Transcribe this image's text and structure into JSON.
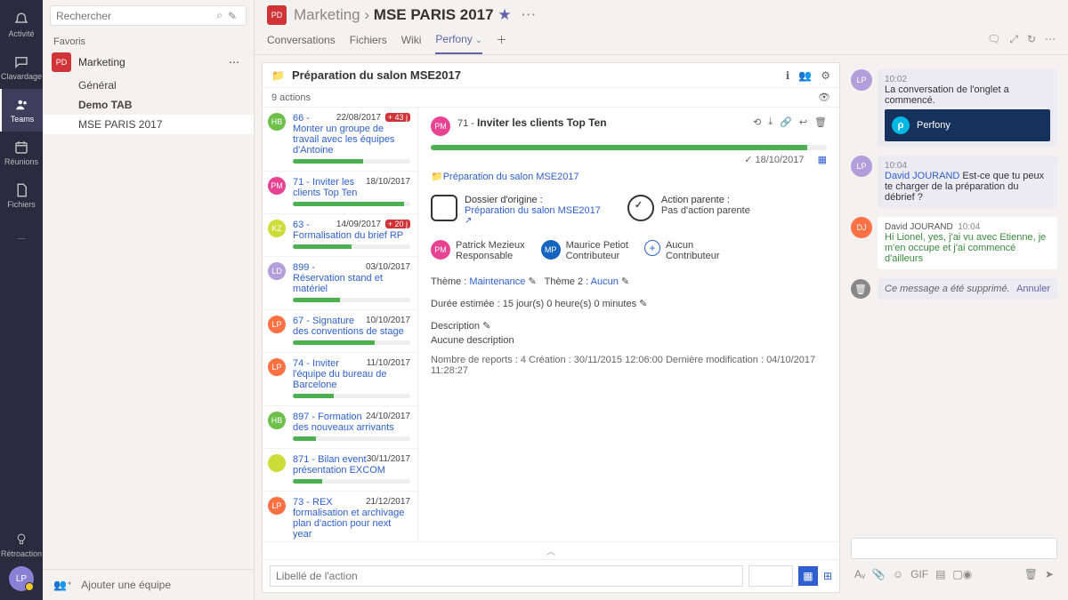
{
  "rail": {
    "items": [
      "Activité",
      "Clavardage",
      "Teams",
      "Réunions",
      "Fichiers"
    ],
    "feedback": "Rétroaction",
    "avatar": "LP"
  },
  "sidebar": {
    "search_placeholder": "Rechercher",
    "favorites_label": "Favoris",
    "team_badge": "PD",
    "team_name": "Marketing",
    "channels": [
      "Général",
      "Demo TAB",
      "MSE PARIS 2017"
    ],
    "add_team": "Ajouter une équipe"
  },
  "header": {
    "badge": "PD",
    "parent": "Marketing",
    "sep": "›",
    "title": "MSE PARIS 2017",
    "tabs": [
      "Conversations",
      "Fichiers",
      "Wiki",
      "Perfony"
    ]
  },
  "perfony": {
    "folder_title": "Préparation du salon MSE2017",
    "actions_count": "9 actions",
    "actions": [
      {
        "av": "HB",
        "color": "#6cc04a",
        "title": "66 - Monter un groupe de travail avec les équipes d'Antoine",
        "date": "22/08/2017",
        "badge": "+ 43 j",
        "progress": 60
      },
      {
        "av": "PM",
        "color": "#e84393",
        "title": "71 - Inviter les clients Top Ten",
        "date": "18/10/2017",
        "progress": 95
      },
      {
        "av": "KZ",
        "color": "#cddc39",
        "title": "63 - Formalisation du brief RP",
        "date": "14/09/2017",
        "badge": "+ 20 j",
        "progress": 50
      },
      {
        "av": "LD",
        "color": "#b39ddb",
        "title": "899 - Réservation stand et matériel",
        "date": "03/10/2017",
        "progress": 40
      },
      {
        "av": "LP",
        "color": "#ff7043",
        "title": "67 - Signature des conventions de stage",
        "date": "10/10/2017",
        "progress": 70
      },
      {
        "av": "LP",
        "color": "#ff7043",
        "title": "74 - Inviter l'équipe du bureau de Barcelone",
        "date": "11/10/2017",
        "progress": 35
      },
      {
        "av": "HB",
        "color": "#6cc04a",
        "title": "897 - Formation des nouveaux arrivants",
        "date": "24/10/2017",
        "progress": 20
      },
      {
        "av": "",
        "color": "#cddc39",
        "title": "871 - Bilan event présentation EXCOM",
        "date": "30/11/2017",
        "progress": 25
      },
      {
        "av": "LP",
        "color": "#ff7043",
        "title": "73 - REX formalisation et archivage plan d'action pour next year",
        "date": "21/12/2017",
        "progress": 5
      }
    ],
    "detail": {
      "num": "71 -",
      "title": "Inviter les clients Top Ten",
      "due_prefix": "✓",
      "due": "18/10/2017",
      "breadcrumb": "📁Préparation du salon MSE2017",
      "dossier_label": "Dossier d'origine :",
      "dossier_value": "Préparation du salon MSE2017",
      "parent_label": "Action parente :",
      "parent_value": "Pas d'action parente",
      "responsable_name": "Patrick Mezieux",
      "responsable_role": "Responsable",
      "contrib1_name": "Maurice Petiot",
      "contrib1_role": "Contributeur",
      "contrib_none": "Aucun",
      "contrib_none_role": "Contributeur",
      "theme_label": "Thème :",
      "theme_value": "Maintenance",
      "theme2_label": "Thème 2 :",
      "theme2_value": "Aucun",
      "duration": "Durée estimée : 15 jour(s) 0 heure(s) 0 minutes ✎",
      "desc_label": "Description ✎",
      "desc_value": "Aucune description",
      "stats": "Nombre de reports : 4    Création : 30/11/2015 12:06:00    Dernière modification : 04/10/2017 11:28:27"
    },
    "input_placeholder": "Libellé de l'action"
  },
  "chat": {
    "messages": [
      {
        "av": "LP",
        "time": "10:02",
        "text": "La conversation de l'onglet a commencé.",
        "card": "Perfony"
      },
      {
        "av": "LP",
        "time": "10:04",
        "author": "David JOURAND",
        "text": "Est-ce que tu peux te charger de la préparation du débrief ?"
      },
      {
        "av": "DJ",
        "avcolor": "#ff7043",
        "author": "David JOURAND",
        "time": "10:04",
        "white": true,
        "text": "Hi Lionel, yes, j'ai vu avec Etienne, je m'en occupe et j'ai commencé d'ailleurs"
      }
    ],
    "deleted": "Ce message a été supprimé.",
    "undo": "Annuler"
  }
}
